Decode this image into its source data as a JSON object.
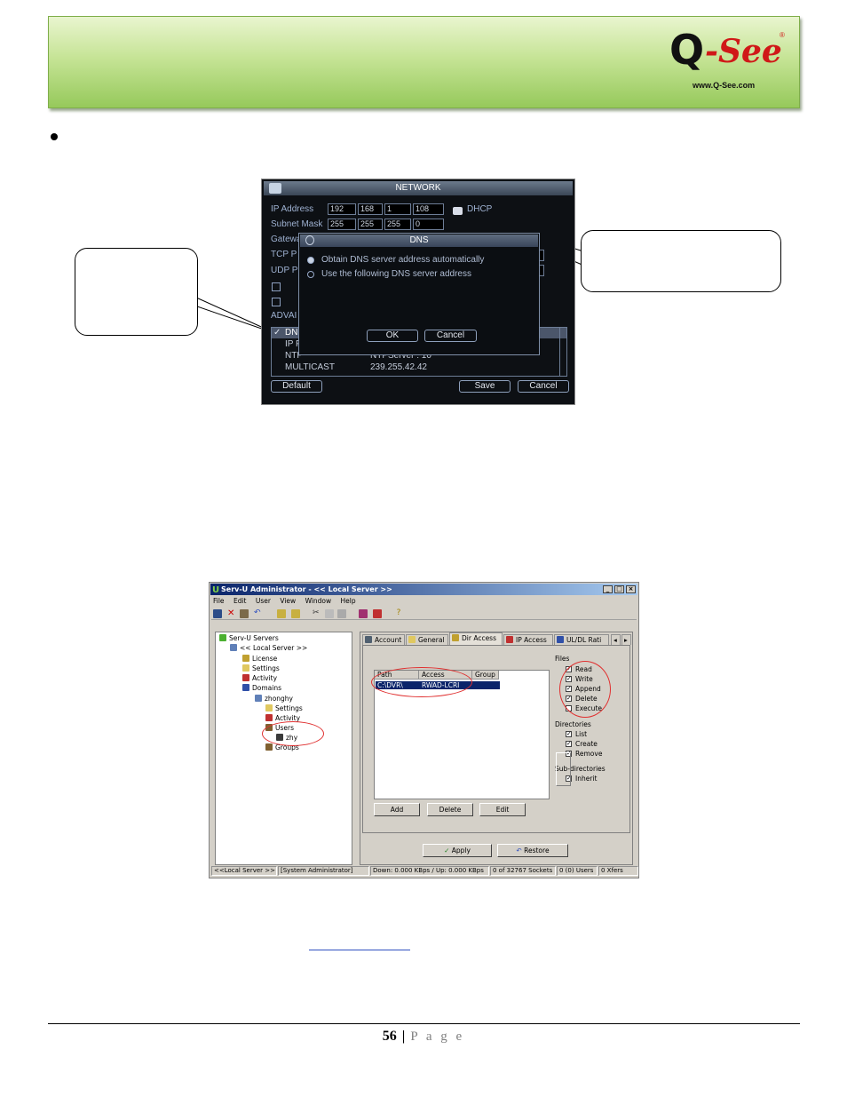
{
  "header": {
    "logo_letter": "Q",
    "logo_word": "-See",
    "logo_registered": "®",
    "logo_url": "www.Q-See.com"
  },
  "dvr": {
    "title": "NETWORK",
    "ip_label": "IP Address",
    "ip": [
      "192",
      "168",
      "1",
      "108"
    ],
    "mask_label": "Subnet Mask",
    "mask": [
      "255",
      "255",
      "255",
      "0"
    ],
    "gateway_label": "Gatewa",
    "tcp_label": "TCP P",
    "udp_label": "UDP P",
    "dhcp_label": "DHCP",
    "advanced_label": "ADVAI",
    "rows": [
      {
        "name": "DN",
        "value": ""
      },
      {
        "name": "IP F",
        "value": ""
      },
      {
        "name": "NTP",
        "value": "NTPServer : 10"
      },
      {
        "name": "MULTICAST",
        "value": "239.255.42.42"
      }
    ],
    "default_btn": "Default",
    "save_btn": "Save",
    "cancel_btn": "Cancel",
    "dns": {
      "title": "DNS",
      "option_auto": "Obtain DNS server address automatically",
      "option_manual": "Use the following DNS server address",
      "ok_btn": "OK",
      "cancel_btn": "Cancel"
    }
  },
  "servu": {
    "title": "Serv-U Administrator - << Local Server >>",
    "menu": [
      "File",
      "Edit",
      "User",
      "View",
      "Window",
      "Help"
    ],
    "tree": [
      {
        "label": "Serv-U Servers",
        "level": 0,
        "icon": "server-icon"
      },
      {
        "label": "<< Local Server >>",
        "level": 1,
        "icon": "computer-icon"
      },
      {
        "label": "License",
        "level": 2,
        "icon": "key-icon"
      },
      {
        "label": "Settings",
        "level": 2,
        "icon": "folder-icon"
      },
      {
        "label": "Activity",
        "level": 2,
        "icon": "activity-icon"
      },
      {
        "label": "Domains",
        "level": 2,
        "icon": "domains-icon"
      },
      {
        "label": "zhonghy",
        "level": 3,
        "icon": "computer-icon"
      },
      {
        "label": "Settings",
        "level": 4,
        "icon": "folder-icon"
      },
      {
        "label": "Activity",
        "level": 4,
        "icon": "activity-icon"
      },
      {
        "label": "Users",
        "level": 4,
        "icon": "users-icon"
      },
      {
        "label": "zhy",
        "level": 5,
        "icon": "user-icon"
      },
      {
        "label": "Groups",
        "level": 4,
        "icon": "groups-icon"
      }
    ],
    "tabs": [
      "Account",
      "General",
      "Dir Access",
      "IP Access",
      "UL/DL Rati"
    ],
    "columns": [
      "Path",
      "Access",
      "Group"
    ],
    "row": {
      "path": "C:\\DVR\\",
      "access": "RWAD-LCRI"
    },
    "files_label": "Files",
    "files": [
      {
        "label": "Read",
        "checked": true
      },
      {
        "label": "Write",
        "checked": true
      },
      {
        "label": "Append",
        "checked": true
      },
      {
        "label": "Delete",
        "checked": true
      },
      {
        "label": "Execute",
        "checked": false
      }
    ],
    "dirs_label": "Directories",
    "dirs": [
      {
        "label": "List",
        "checked": true
      },
      {
        "label": "Create",
        "checked": true
      },
      {
        "label": "Remove",
        "checked": true
      }
    ],
    "subdirs_label": "Sub-directories",
    "inherit_label": "Inherit",
    "add_btn": "Add",
    "delete_btn": "Delete",
    "edit_btn": "Edit",
    "apply_btn": "Apply",
    "restore_btn": "Restore",
    "status": [
      "<<Local Server >>",
      "[System Administrator]",
      "Down: 0.000 KBps / Up: 0.000 KBps",
      "0 of 32767 Sockets",
      "0 (0) Users",
      "0 Xfers"
    ]
  },
  "footer": {
    "page_number": "56",
    "separator": "|",
    "page_word": "P a g e"
  }
}
